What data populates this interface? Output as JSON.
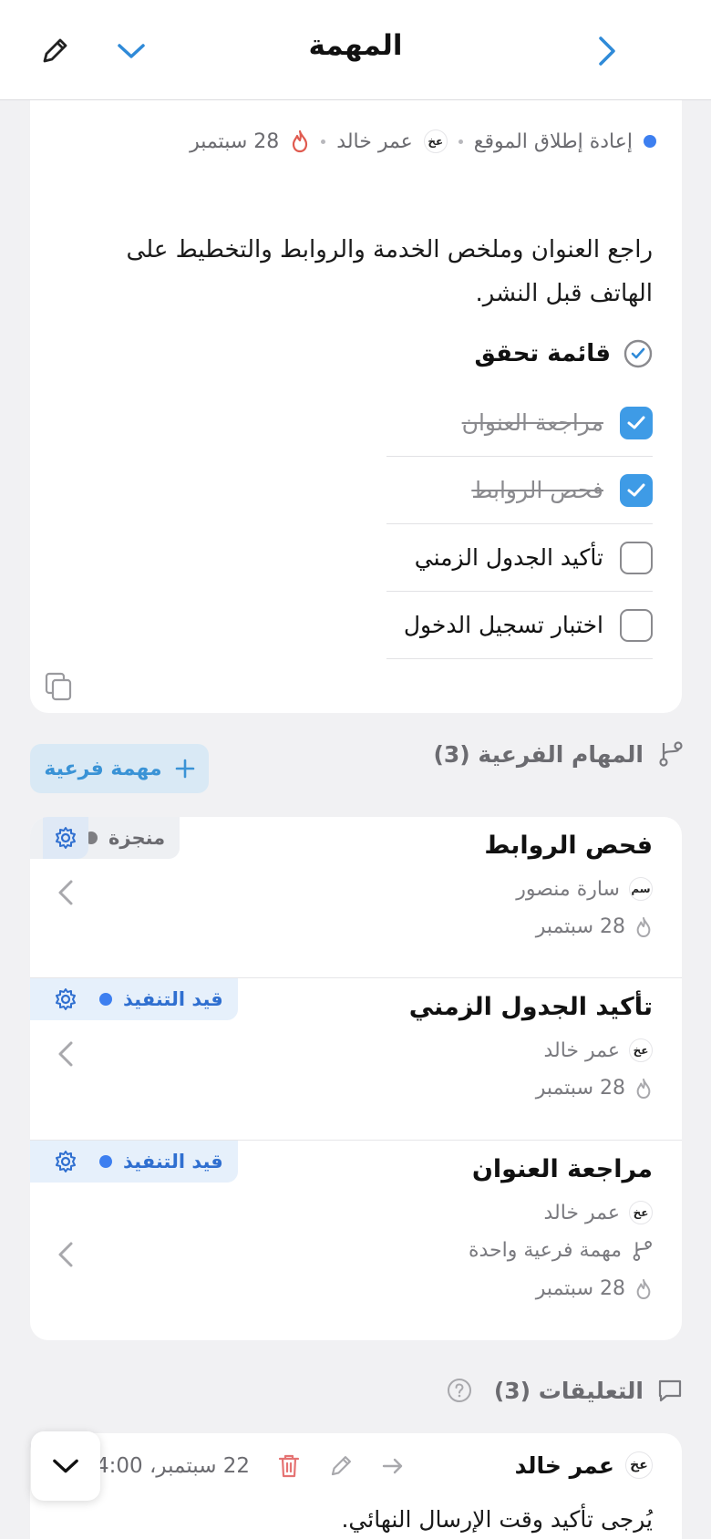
{
  "header": {
    "title": "المهمة",
    "back_icon": "chevron-right-icon",
    "expand_icon": "chevron-down-icon",
    "edit_icon": "pencil-icon"
  },
  "task": {
    "project": "إعادة إطلاق الموقع",
    "assignee_initials": "عخ",
    "assignee_name": "عمر خالد",
    "due_date": "28 سبتمبر",
    "description": "راجع العنوان وملخص الخدمة والروابط والتخطيط على الهاتف قبل النشر.",
    "checklist_title": "قائمة تحقق",
    "checklist": [
      {
        "label": "مراجعة العنوان",
        "checked": true
      },
      {
        "label": "فحص الروابط",
        "checked": true
      },
      {
        "label": "تأكيد الجدول الزمني",
        "checked": false
      },
      {
        "label": "اختبار تسجيل الدخول",
        "checked": false
      }
    ]
  },
  "subtasks": {
    "header": "المهام الفرعية (3)",
    "add_label": "مهمة فرعية",
    "items": [
      {
        "title": "فحص الروابط",
        "status": "منجزة",
        "assignee_initials": "سم",
        "assignee": "سارة منصور",
        "date": "28 سبتمبر"
      },
      {
        "title": "تأكيد الجدول الزمني",
        "status": "قيد التنفيذ",
        "assignee_initials": "عخ",
        "assignee": "عمر خالد",
        "date": "28 سبتمبر"
      },
      {
        "title": "مراجعة العنوان",
        "status": "قيد التنفيذ",
        "assignee_initials": "عخ",
        "assignee": "عمر خالد",
        "subtask_count": "مهمة فرعية واحدة",
        "date": "28 سبتمبر"
      }
    ]
  },
  "comments": {
    "header": "التعليقات (3)",
    "items": [
      {
        "author_initials": "عخ",
        "author": "عمر خالد",
        "date": "22 سبتمبر، 4:00",
        "body": "يُرجى تأكيد وقت الإرسال النهائي."
      }
    ]
  },
  "colors": {
    "accent": "#3e9be6",
    "status_blue": "#3d7ff0",
    "danger": "#e57373"
  }
}
